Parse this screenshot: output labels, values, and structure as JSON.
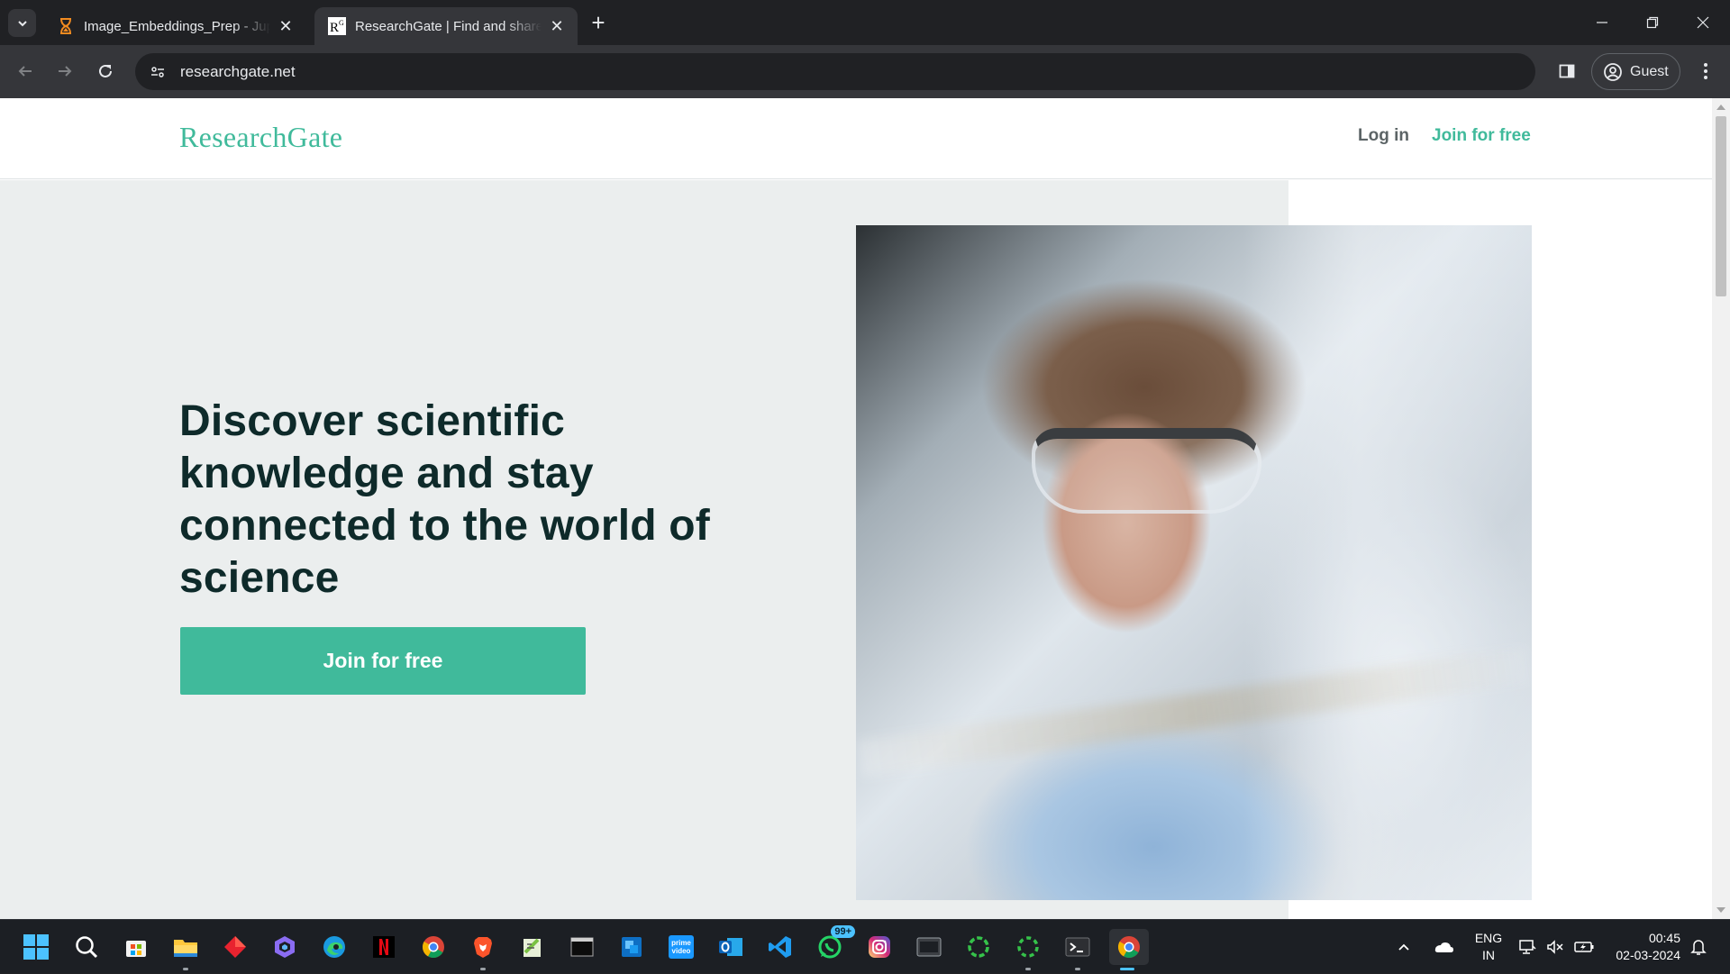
{
  "browser": {
    "tabs": [
      {
        "title": "Image_Embeddings_Prep - Jupyter",
        "active": false,
        "favicon": "hourglass-icon"
      },
      {
        "title": "ResearchGate | Find and share research",
        "active": true,
        "favicon": "researchgate-favicon"
      }
    ],
    "address_bar": {
      "url": "researchgate.net"
    },
    "profile": {
      "label": "Guest"
    }
  },
  "page": {
    "header": {
      "logo": "ResearchGate",
      "login": "Log in",
      "join": "Join for free"
    },
    "hero": {
      "title": "Discover scientific knowledge and stay connected to the world of science",
      "cta": "Join for free",
      "image_alt_subject": "scientist-in-lab-photo"
    },
    "colors": {
      "brand": "#40BA9B",
      "hero_bg": "#EBEEEE",
      "title_text": "#0E2A2A",
      "login_text": "#5C6466"
    }
  },
  "taskbar": {
    "apps": [
      "windows-start-icon",
      "search-icon",
      "microsoft-store-icon",
      "file-explorer-icon",
      "app-red-icon",
      "copilot-icon",
      "edge-icon",
      "netflix-icon",
      "chrome-icon",
      "brave-icon",
      "notepad-plus-icon",
      "terminal-window-icon",
      "app-blue-icon",
      "prime-video-icon",
      "outlook-icon",
      "vscode-icon",
      "whatsapp-icon",
      "instagram-icon",
      "console-app-icon",
      "spinner-app-icon",
      "spinner-app-2-icon",
      "terminal-icon",
      "chrome-active-icon"
    ],
    "whatsapp_badge": "99+",
    "language": {
      "line1": "ENG",
      "line2": "IN"
    },
    "clock": {
      "time": "00:45",
      "date": "02-03-2024"
    }
  }
}
